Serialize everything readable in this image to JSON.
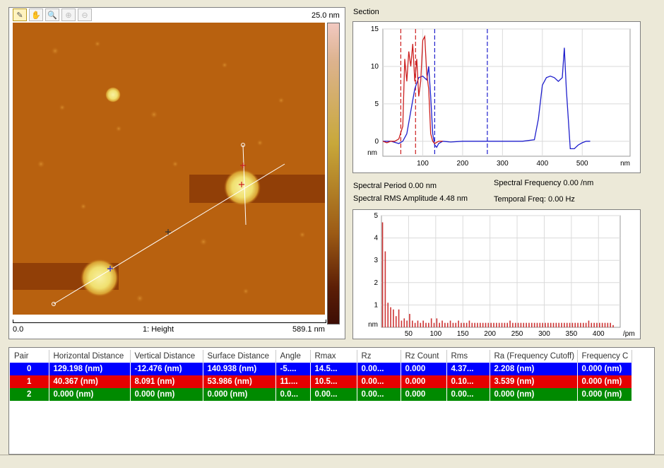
{
  "toolbar": {
    "tools": [
      {
        "icon": "ruler-icon",
        "glyph": "✎",
        "active": true
      },
      {
        "icon": "hand-icon",
        "glyph": "✋",
        "active": false
      },
      {
        "icon": "magnifier-icon",
        "glyph": "🔍",
        "active": false
      },
      {
        "icon": "zoom-in-icon",
        "glyph": "⊕",
        "active": false,
        "disabled": true
      },
      {
        "icon": "zoom-out-icon",
        "glyph": "⊖",
        "active": false,
        "disabled": true
      }
    ]
  },
  "image": {
    "z_max_label": "25.0 nm",
    "x_min_label": "0.0",
    "x_max_label": "589.1 nm",
    "channel_label": "1: Height"
  },
  "section": {
    "title": "Section",
    "x_unit": "nm",
    "y_unit": "nm",
    "spectral_period": "Spectral Period 0.00 nm",
    "spectral_freq": "Spectral Frequency 0.00 /nm",
    "rms_amplitude": "Spectral RMS Amplitude 4.48 nm",
    "temporal_freq": "Temporal Freq: 0.00 Hz"
  },
  "chart_data": [
    {
      "type": "line",
      "title": "Section",
      "xlabel": "nm",
      "ylabel": "nm",
      "xlim": [
        0,
        620
      ],
      "ylim": [
        -2,
        15
      ],
      "x_ticks": [
        100,
        200,
        300,
        400,
        500
      ],
      "y_ticks": [
        0,
        5,
        10,
        15
      ],
      "series": [
        {
          "color": "#1f1fcc",
          "x": [
            0,
            20,
            40,
            50,
            60,
            70,
            80,
            90,
            100,
            110,
            115,
            120,
            125,
            130,
            135,
            140,
            150,
            170,
            200,
            250,
            300,
            350,
            380,
            390,
            400,
            410,
            420,
            430,
            440,
            450,
            455,
            460,
            470,
            480,
            490,
            500,
            510,
            520
          ],
          "y": [
            0,
            0,
            -0.3,
            0,
            1,
            4,
            7,
            8.5,
            8.7,
            8.2,
            10,
            6,
            1,
            -0.5,
            -0.8,
            -0.3,
            0,
            -0.1,
            0,
            0,
            0,
            0,
            0.2,
            3,
            7.5,
            8.5,
            8.7,
            8.5,
            8,
            8.5,
            12.5,
            7,
            -1,
            -1,
            -0.5,
            -0.2,
            0,
            0
          ]
        },
        {
          "color": "#cc1f1f",
          "x": [
            0,
            10,
            20,
            30,
            40,
            50,
            55,
            60,
            65,
            70,
            75,
            80,
            85,
            90,
            95,
            100,
            105,
            110,
            115,
            120,
            125,
            130,
            140,
            150
          ],
          "y": [
            0,
            -0.2,
            0,
            0,
            0.3,
            2,
            11,
            8,
            12,
            10,
            13,
            8,
            11,
            6,
            8,
            13.5,
            14,
            9,
            7,
            1,
            0,
            -0.3,
            0,
            0
          ]
        }
      ],
      "cursors": [
        {
          "x": 45,
          "color": "#cc1f1f"
        },
        {
          "x": 82,
          "color": "#cc1f1f"
        },
        {
          "x": 130,
          "color": "#1f1fcc"
        },
        {
          "x": 262,
          "color": "#1f1fcc"
        }
      ]
    },
    {
      "type": "bar",
      "title": "",
      "xlabel": "/pm",
      "ylabel": "nm",
      "xlim": [
        0,
        440
      ],
      "ylim": [
        0,
        5
      ],
      "x_ticks": [
        50,
        100,
        150,
        200,
        250,
        300,
        350,
        400
      ],
      "y_ticks": [
        1,
        2,
        3,
        4,
        5
      ],
      "color": "#cc3333",
      "x": [
        2,
        7,
        12,
        17,
        22,
        27,
        32,
        37,
        42,
        47,
        52,
        57,
        62,
        67,
        72,
        77,
        82,
        87,
        92,
        97,
        102,
        107,
        112,
        117,
        122,
        127,
        132,
        137,
        142,
        147,
        152,
        157,
        162,
        167,
        172,
        177,
        182,
        187,
        192,
        197,
        202,
        207,
        212,
        217,
        222,
        227,
        232,
        237,
        242,
        247,
        252,
        257,
        262,
        267,
        272,
        277,
        282,
        287,
        292,
        297,
        302,
        307,
        312,
        317,
        322,
        327,
        332,
        337,
        342,
        347,
        352,
        357,
        362,
        367,
        372,
        377,
        382,
        387,
        392,
        397,
        402,
        407,
        412,
        417,
        422,
        427
      ],
      "values": [
        4.7,
        3.4,
        1.1,
        0.9,
        0.8,
        0.5,
        0.8,
        0.3,
        0.4,
        0.3,
        0.6,
        0.3,
        0.2,
        0.3,
        0.2,
        0.3,
        0.2,
        0.2,
        0.4,
        0.2,
        0.4,
        0.2,
        0.3,
        0.2,
        0.2,
        0.3,
        0.2,
        0.2,
        0.3,
        0.2,
        0.2,
        0.2,
        0.3,
        0.2,
        0.2,
        0.2,
        0.2,
        0.2,
        0.2,
        0.2,
        0.2,
        0.2,
        0.2,
        0.2,
        0.2,
        0.2,
        0.2,
        0.3,
        0.2,
        0.2,
        0.2,
        0.2,
        0.2,
        0.2,
        0.2,
        0.2,
        0.2,
        0.2,
        0.2,
        0.2,
        0.2,
        0.2,
        0.2,
        0.2,
        0.2,
        0.2,
        0.2,
        0.2,
        0.2,
        0.2,
        0.2,
        0.2,
        0.2,
        0.2,
        0.2,
        0.2,
        0.3,
        0.2,
        0.2,
        0.2,
        0.2,
        0.2,
        0.2,
        0.2,
        0.2,
        0.1
      ]
    }
  ],
  "table": {
    "columns": [
      "Pair",
      "Horizontal Distance",
      "Vertical Distance",
      "Surface Distance",
      "Angle",
      "Rmax",
      "Rz",
      "Rz Count",
      "Rms",
      "Ra (Frequency Cutoff)",
      "Frequency C"
    ],
    "rows": [
      {
        "cells": [
          "0",
          "129.198 (nm)",
          "-12.476 (nm)",
          "140.938 (nm)",
          "-5....",
          "14.5...",
          "0.00...",
          "0.000",
          "4.37...",
          "2.208 (nm)",
          "0.000 (nm)"
        ],
        "color": "#0000ff"
      },
      {
        "cells": [
          "1",
          "40.367 (nm)",
          "8.091 (nm)",
          "53.986 (nm)",
          "11....",
          "10.5...",
          "0.00...",
          "0.000",
          "0.10...",
          "3.539 (nm)",
          "0.000 (nm)"
        ],
        "color": "#e60000"
      },
      {
        "cells": [
          "2",
          "0.000 (nm)",
          "0.000 (nm)",
          "0.000 (nm)",
          "0.0...",
          "0.00...",
          "0.00...",
          "0.000",
          "0.00...",
          "0.000 (nm)",
          "0.000 (nm)"
        ],
        "color": "#008a00"
      }
    ]
  },
  "colors": {
    "afm_background": "#b8610f",
    "colorbar_top": "#f2c9c1",
    "colorbar_mid": "#c8a83a",
    "colorbar_bottom": "#3d0d05"
  }
}
